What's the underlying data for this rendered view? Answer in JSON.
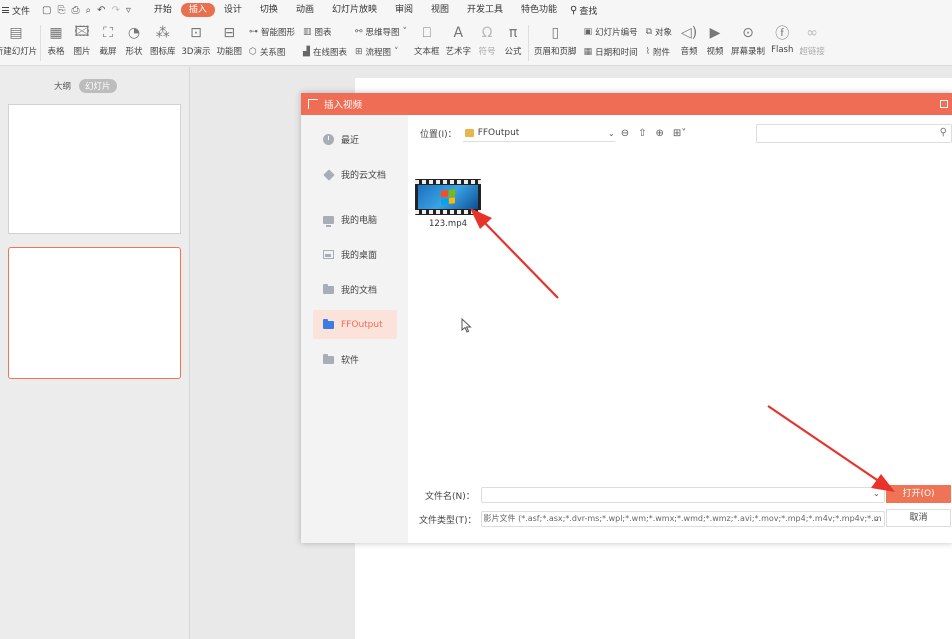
{
  "menubar": {
    "file_label": "文件",
    "menus": [
      "开始",
      "插入",
      "设计",
      "切换",
      "动画",
      "幻灯片放映",
      "审阅",
      "视图",
      "开发工具",
      "特色功能"
    ],
    "active_menu": "插入",
    "search_label": "查找"
  },
  "ribbon": {
    "new_slide": "新建幻灯片",
    "table": "表格",
    "picture": "图片",
    "screenshot": "截屏",
    "shape": "形状",
    "icon_lib": "图标库",
    "demo3d": "3D演示",
    "func_chart": "功能图",
    "smart_art": "智能图形",
    "chart": "图表",
    "mind_map": "思维导图",
    "relation": "关系图",
    "online_chart": "在线图表",
    "flowchart": "流程图",
    "textbox": "文本框",
    "wordart": "艺术字",
    "symbol": "符号",
    "formula": "公式",
    "header_footer": "页眉和页脚",
    "slide_number": "幻灯片编号",
    "object": "对象",
    "datetime": "日期和时间",
    "attachment": "附件",
    "audio": "音频",
    "video": "视频",
    "screen_record": "屏幕录制",
    "flash": "Flash",
    "hyperlink": "超链接"
  },
  "left_panel": {
    "tab_outline": "大纲",
    "tab_slides": "幻灯片"
  },
  "dialog": {
    "title": "插入视频",
    "sidebar": [
      "最近",
      "我的云文档",
      "我的电脑",
      "我的桌面",
      "我的文档",
      "FFOutput",
      "软件"
    ],
    "selected_location": "FFOutput",
    "location_label": "位置(I)：",
    "location_value": "FFOutput",
    "search_placeholder": "",
    "files": [
      {
        "name": "123.mp4"
      }
    ],
    "filename_label": "文件名(N)：",
    "filename_value": "",
    "filetype_label": "文件类型(T)：",
    "filetype_value": "影片文件 (*.asf;*.asx;*.dvr-ms;*.wpl;*.wm;*.wmx;*.wmd;*.wmz;*.avi;*.mov;*.mp4;*.m4v;*.mp4v;*.m",
    "open_button": "打开(O)",
    "cancel_button": "取消"
  },
  "colors": {
    "accent": "#ef6d55",
    "annotation_arrow": "#e8322a"
  }
}
